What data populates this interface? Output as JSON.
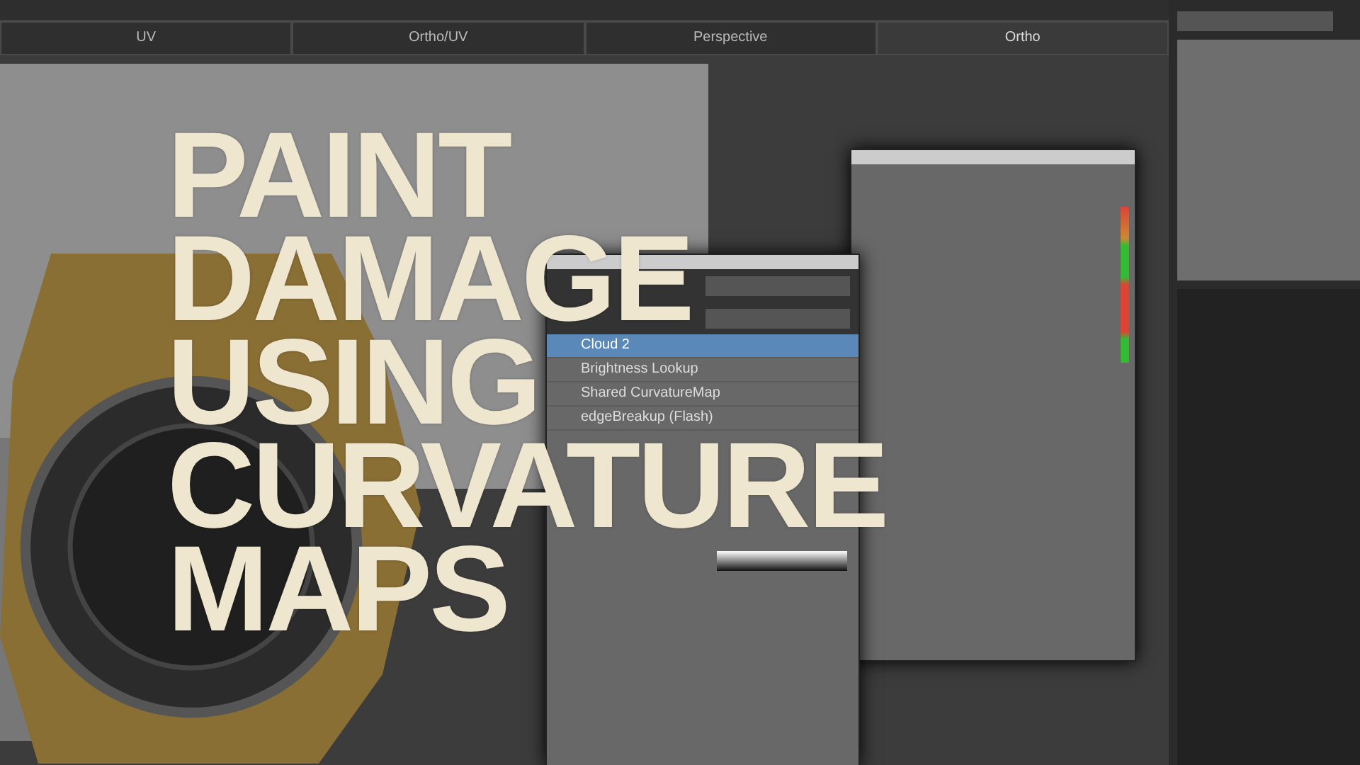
{
  "viewport_tabs": [
    {
      "label": "UV",
      "selected": false
    },
    {
      "label": "Ortho/UV",
      "selected": false
    },
    {
      "label": "Perspective",
      "selected": false
    },
    {
      "label": "Ortho",
      "selected": true
    }
  ],
  "layers_panel": {
    "layers": [
      {
        "name": "Cloud 2",
        "selected": true
      },
      {
        "name": "Brightness Lookup",
        "selected": false
      },
      {
        "name": "Shared CurvatureMap",
        "selected": false
      },
      {
        "name": "edgeBreakup (Flash)",
        "selected": false
      }
    ]
  },
  "title_lines": [
    "PAINT",
    "DAMAGE",
    "USING",
    "CURVATURE",
    "MAPS"
  ]
}
